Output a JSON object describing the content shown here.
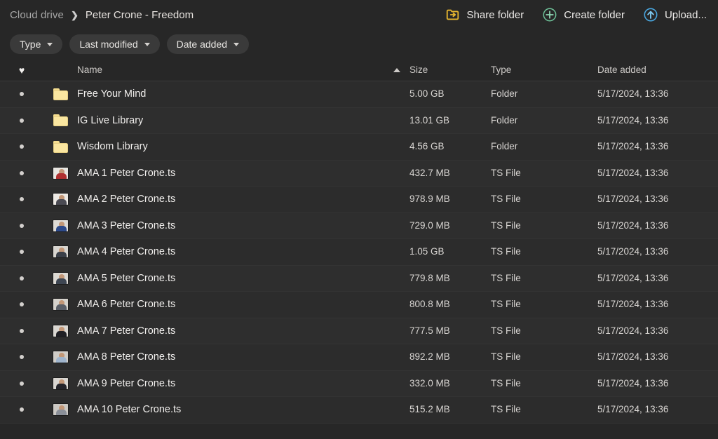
{
  "breadcrumb": {
    "root": "Cloud drive",
    "separator": "❯",
    "current": "Peter Crone - Freedom"
  },
  "toolbar": {
    "items": [
      {
        "label": "Share folder",
        "icon": "share-folder-icon",
        "color": "#e8b730"
      },
      {
        "label": "Create folder",
        "icon": "create-folder-icon",
        "color": "#5fbf8f"
      },
      {
        "label": "Upload...",
        "icon": "upload-icon",
        "color": "#49a7e0"
      }
    ]
  },
  "filters": [
    {
      "label": "Type",
      "icon": "chevron-down-icon"
    },
    {
      "label": "Last modified",
      "icon": "chevron-down-icon"
    },
    {
      "label": "Date added",
      "icon": "chevron-down-icon"
    }
  ],
  "columns": {
    "favorite": "",
    "favorite_icon": "heart-icon",
    "name": "Name",
    "sort_icon": "caret-up-icon",
    "size": "Size",
    "type": "Type",
    "date_added": "Date added"
  },
  "rows": [
    {
      "name": "Free Your Mind",
      "size": "5.00 GB",
      "type": "Folder",
      "date": "5/17/2024, 13:36",
      "kind": "folder",
      "thumb_bg": "",
      "thumb_body": ""
    },
    {
      "name": "IG Live Library",
      "size": "13.01 GB",
      "type": "Folder",
      "date": "5/17/2024, 13:36",
      "kind": "folder",
      "thumb_bg": "",
      "thumb_body": ""
    },
    {
      "name": "Wisdom Library",
      "size": "4.56 GB",
      "type": "Folder",
      "date": "5/17/2024, 13:36",
      "kind": "folder",
      "thumb_bg": "",
      "thumb_body": ""
    },
    {
      "name": "AMA 1 Peter Crone.ts",
      "size": "432.7 MB",
      "type": "TS File",
      "date": "5/17/2024, 13:36",
      "kind": "file",
      "thumb_bg": "#e8e6e1",
      "thumb_body": "#b03030"
    },
    {
      "name": "AMA 2 Peter Crone.ts",
      "size": "978.9 MB",
      "type": "TS File",
      "date": "5/17/2024, 13:36",
      "kind": "file",
      "thumb_bg": "#ece9e4",
      "thumb_body": "#4a4a52"
    },
    {
      "name": "AMA 3 Peter Crone.ts",
      "size": "729.0 MB",
      "type": "TS File",
      "date": "5/17/2024, 13:36",
      "kind": "file",
      "thumb_bg": "#dedbd6",
      "thumb_body": "#2d4a8a"
    },
    {
      "name": "AMA 4 Peter Crone.ts",
      "size": "1.05 GB",
      "type": "TS File",
      "date": "5/17/2024, 13:36",
      "kind": "file",
      "thumb_bg": "#d8d5d0",
      "thumb_body": "#3a3f48"
    },
    {
      "name": "AMA 5 Peter Crone.ts",
      "size": "779.8 MB",
      "type": "TS File",
      "date": "5/17/2024, 13:36",
      "kind": "file",
      "thumb_bg": "#dcd9d3",
      "thumb_body": "#3e4652"
    },
    {
      "name": "AMA 6 Peter Crone.ts",
      "size": "800.8 MB",
      "type": "TS File",
      "date": "5/17/2024, 13:36",
      "kind": "file",
      "thumb_bg": "#d5d2cc",
      "thumb_body": "#5a5f68"
    },
    {
      "name": "AMA 7 Peter Crone.ts",
      "size": "777.5 MB",
      "type": "TS File",
      "date": "5/17/2024, 13:36",
      "kind": "file",
      "thumb_bg": "#dad7d2",
      "thumb_body": "#1f1f24"
    },
    {
      "name": "AMA 8 Peter Crone.ts",
      "size": "892.2 MB",
      "type": "TS File",
      "date": "5/17/2024, 13:36",
      "kind": "file",
      "thumb_bg": "#cfccc7",
      "thumb_body": "#9fb4cc"
    },
    {
      "name": "AMA 9 Peter Crone.ts",
      "size": "332.0 MB",
      "type": "TS File",
      "date": "5/17/2024, 13:36",
      "kind": "file",
      "thumb_bg": "#d9d6d1",
      "thumb_body": "#24242a"
    },
    {
      "name": "AMA 10 Peter Crone.ts",
      "size": "515.2 MB",
      "type": "TS File",
      "date": "5/17/2024, 13:36",
      "kind": "file",
      "thumb_bg": "#cbc8c3",
      "thumb_body": "#8a8f98"
    }
  ]
}
